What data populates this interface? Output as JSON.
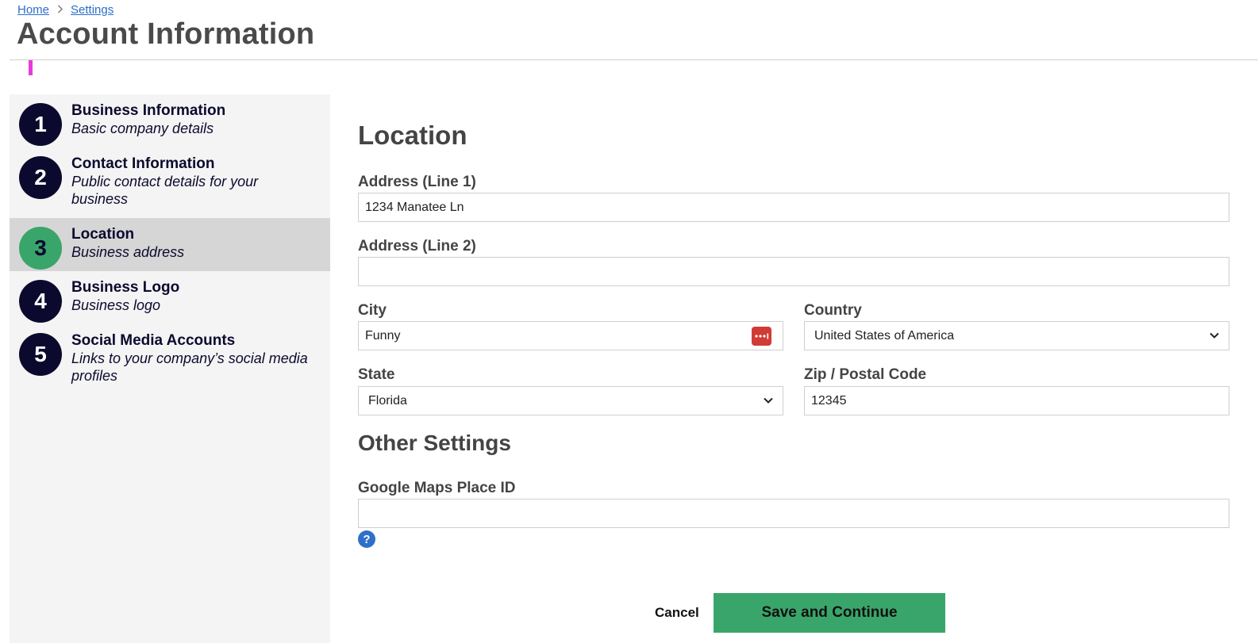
{
  "breadcrumb": {
    "home": "Home",
    "settings": "Settings"
  },
  "page_title": "Account Information",
  "steps": [
    {
      "number": "1",
      "title": "Business Information",
      "subtitle": "Basic company details"
    },
    {
      "number": "2",
      "title": "Contact Information",
      "subtitle": "Public contact details for your business"
    },
    {
      "number": "3",
      "title": "Location",
      "subtitle": "Business address",
      "active": true
    },
    {
      "number": "4",
      "title": "Business Logo",
      "subtitle": "Business logo"
    },
    {
      "number": "5",
      "title": "Social Media Accounts",
      "subtitle": "Links to your company’s social media profiles"
    }
  ],
  "form": {
    "section_title": "Location",
    "address1": {
      "label": "Address (Line 1)",
      "value": "1234 Manatee Ln"
    },
    "address2": {
      "label": "Address (Line 2)",
      "value": ""
    },
    "city": {
      "label": "City",
      "value": "Funny"
    },
    "country": {
      "label": "Country",
      "value": "United States of America"
    },
    "state": {
      "label": "State",
      "value": "Florida"
    },
    "zip": {
      "label": "Zip / Postal Code",
      "value": "12345"
    },
    "other_title": "Other Settings",
    "place_id": {
      "label": "Google Maps Place ID",
      "value": ""
    },
    "help_glyph": "?"
  },
  "actions": {
    "cancel": "Cancel",
    "save": "Save and Continue"
  },
  "colors": {
    "accent_green": "#3aa56a",
    "step_navy": "#0b0a2e",
    "link_blue": "#2a6fc9",
    "marker_pink": "#e83ad9",
    "password_icon_red": "#d13b35"
  },
  "icons": {
    "breadcrumb_separator": "chevron-right-icon",
    "select_arrow": "chevron-down-icon",
    "password_manager": "password-manager-icon",
    "help": "help-icon"
  }
}
